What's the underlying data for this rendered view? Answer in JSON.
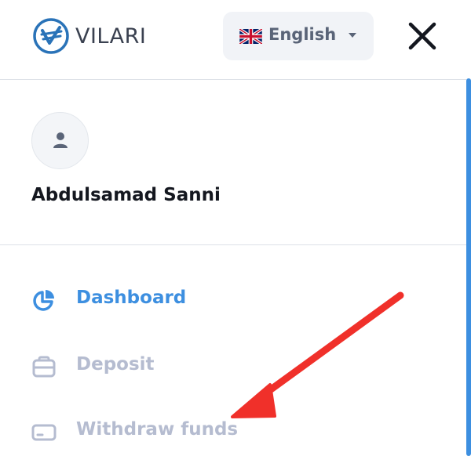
{
  "header": {
    "brand": "VILARI",
    "language": {
      "label": "English",
      "flag": "uk-flag-icon"
    },
    "close_icon": "close-icon"
  },
  "profile": {
    "name": "Abdulsamad Sanni",
    "avatar_icon": "user-icon"
  },
  "menu": {
    "items": [
      {
        "label": "Dashboard",
        "icon": "pie-chart-icon",
        "active": true
      },
      {
        "label": "Deposit",
        "icon": "wallet-icon",
        "active": false
      },
      {
        "label": "Withdraw funds",
        "icon": "card-icon",
        "active": false
      }
    ]
  },
  "colors": {
    "accent": "#3d8fe0",
    "inactive": "#b5bcd0",
    "annotation_arrow": "#f0302a"
  }
}
